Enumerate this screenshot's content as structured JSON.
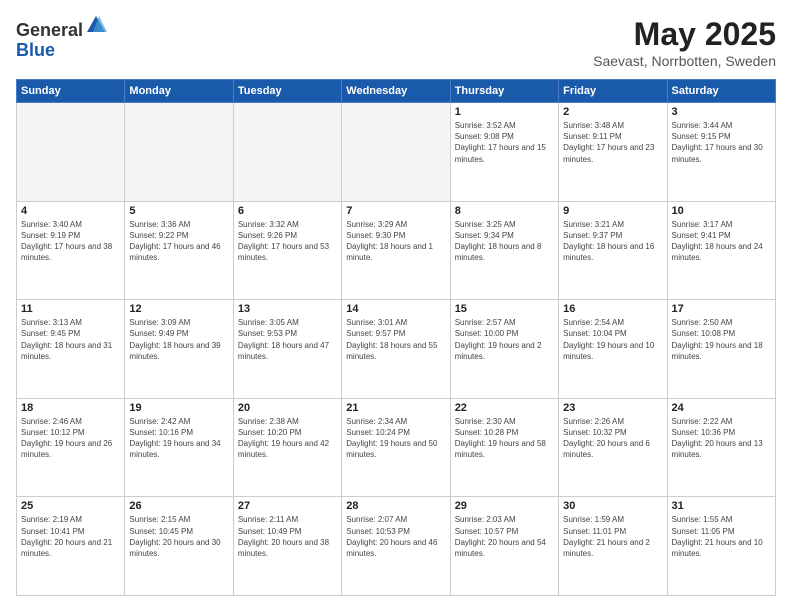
{
  "header": {
    "logo_general": "General",
    "logo_blue": "Blue",
    "month_title": "May 2025",
    "location": "Saevast, Norrbotten, Sweden"
  },
  "weekdays": [
    "Sunday",
    "Monday",
    "Tuesday",
    "Wednesday",
    "Thursday",
    "Friday",
    "Saturday"
  ],
  "weeks": [
    [
      {
        "day": "",
        "info": ""
      },
      {
        "day": "",
        "info": ""
      },
      {
        "day": "",
        "info": ""
      },
      {
        "day": "",
        "info": ""
      },
      {
        "day": "1",
        "info": "Sunrise: 3:52 AM\nSunset: 9:08 PM\nDaylight: 17 hours and 15 minutes."
      },
      {
        "day": "2",
        "info": "Sunrise: 3:48 AM\nSunset: 9:11 PM\nDaylight: 17 hours and 23 minutes."
      },
      {
        "day": "3",
        "info": "Sunrise: 3:44 AM\nSunset: 9:15 PM\nDaylight: 17 hours and 30 minutes."
      }
    ],
    [
      {
        "day": "4",
        "info": "Sunrise: 3:40 AM\nSunset: 9:19 PM\nDaylight: 17 hours and 38 minutes."
      },
      {
        "day": "5",
        "info": "Sunrise: 3:36 AM\nSunset: 9:22 PM\nDaylight: 17 hours and 46 minutes."
      },
      {
        "day": "6",
        "info": "Sunrise: 3:32 AM\nSunset: 9:26 PM\nDaylight: 17 hours and 53 minutes."
      },
      {
        "day": "7",
        "info": "Sunrise: 3:29 AM\nSunset: 9:30 PM\nDaylight: 18 hours and 1 minute."
      },
      {
        "day": "8",
        "info": "Sunrise: 3:25 AM\nSunset: 9:34 PM\nDaylight: 18 hours and 8 minutes."
      },
      {
        "day": "9",
        "info": "Sunrise: 3:21 AM\nSunset: 9:37 PM\nDaylight: 18 hours and 16 minutes."
      },
      {
        "day": "10",
        "info": "Sunrise: 3:17 AM\nSunset: 9:41 PM\nDaylight: 18 hours and 24 minutes."
      }
    ],
    [
      {
        "day": "11",
        "info": "Sunrise: 3:13 AM\nSunset: 9:45 PM\nDaylight: 18 hours and 31 minutes."
      },
      {
        "day": "12",
        "info": "Sunrise: 3:09 AM\nSunset: 9:49 PM\nDaylight: 18 hours and 39 minutes."
      },
      {
        "day": "13",
        "info": "Sunrise: 3:05 AM\nSunset: 9:53 PM\nDaylight: 18 hours and 47 minutes."
      },
      {
        "day": "14",
        "info": "Sunrise: 3:01 AM\nSunset: 9:57 PM\nDaylight: 18 hours and 55 minutes."
      },
      {
        "day": "15",
        "info": "Sunrise: 2:57 AM\nSunset: 10:00 PM\nDaylight: 19 hours and 2 minutes."
      },
      {
        "day": "16",
        "info": "Sunrise: 2:54 AM\nSunset: 10:04 PM\nDaylight: 19 hours and 10 minutes."
      },
      {
        "day": "17",
        "info": "Sunrise: 2:50 AM\nSunset: 10:08 PM\nDaylight: 19 hours and 18 minutes."
      }
    ],
    [
      {
        "day": "18",
        "info": "Sunrise: 2:46 AM\nSunset: 10:12 PM\nDaylight: 19 hours and 26 minutes."
      },
      {
        "day": "19",
        "info": "Sunrise: 2:42 AM\nSunset: 10:16 PM\nDaylight: 19 hours and 34 minutes."
      },
      {
        "day": "20",
        "info": "Sunrise: 2:38 AM\nSunset: 10:20 PM\nDaylight: 19 hours and 42 minutes."
      },
      {
        "day": "21",
        "info": "Sunrise: 2:34 AM\nSunset: 10:24 PM\nDaylight: 19 hours and 50 minutes."
      },
      {
        "day": "22",
        "info": "Sunrise: 2:30 AM\nSunset: 10:28 PM\nDaylight: 19 hours and 58 minutes."
      },
      {
        "day": "23",
        "info": "Sunrise: 2:26 AM\nSunset: 10:32 PM\nDaylight: 20 hours and 6 minutes."
      },
      {
        "day": "24",
        "info": "Sunrise: 2:22 AM\nSunset: 10:36 PM\nDaylight: 20 hours and 13 minutes."
      }
    ],
    [
      {
        "day": "25",
        "info": "Sunrise: 2:19 AM\nSunset: 10:41 PM\nDaylight: 20 hours and 21 minutes."
      },
      {
        "day": "26",
        "info": "Sunrise: 2:15 AM\nSunset: 10:45 PM\nDaylight: 20 hours and 30 minutes."
      },
      {
        "day": "27",
        "info": "Sunrise: 2:11 AM\nSunset: 10:49 PM\nDaylight: 20 hours and 38 minutes."
      },
      {
        "day": "28",
        "info": "Sunrise: 2:07 AM\nSunset: 10:53 PM\nDaylight: 20 hours and 46 minutes."
      },
      {
        "day": "29",
        "info": "Sunrise: 2:03 AM\nSunset: 10:57 PM\nDaylight: 20 hours and 54 minutes."
      },
      {
        "day": "30",
        "info": "Sunrise: 1:59 AM\nSunset: 11:01 PM\nDaylight: 21 hours and 2 minutes."
      },
      {
        "day": "31",
        "info": "Sunrise: 1:55 AM\nSunset: 11:05 PM\nDaylight: 21 hours and 10 minutes."
      }
    ]
  ]
}
